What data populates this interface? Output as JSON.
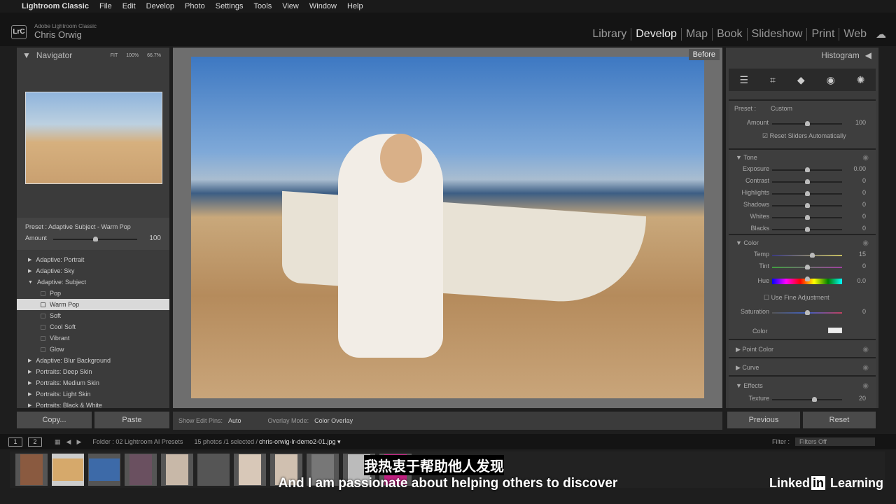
{
  "menubar": {
    "app": "Lightroom Classic",
    "items": [
      "File",
      "Edit",
      "Develop",
      "Photo",
      "Settings",
      "Tools",
      "View",
      "Window",
      "Help"
    ]
  },
  "identity": {
    "logo": "LrC",
    "product": "Adobe Lightroom Classic",
    "user": "Chris Orwig"
  },
  "modules": [
    {
      "label": "Library",
      "active": false
    },
    {
      "label": "Develop",
      "active": true
    },
    {
      "label": "Map",
      "active": false
    },
    {
      "label": "Book",
      "active": false
    },
    {
      "label": "Slideshow",
      "active": false
    },
    {
      "label": "Print",
      "active": false
    },
    {
      "label": "Web",
      "active": false
    }
  ],
  "navigator": {
    "title": "Navigator",
    "zooms": [
      "FIT",
      "100%",
      "66.7%"
    ]
  },
  "preset_box": {
    "label": "Preset : Adaptive Subject - Warm Pop",
    "amount_label": "Amount",
    "amount": "100",
    "amount_fraction": 0.5
  },
  "presets": [
    {
      "label": "Adaptive: Portrait",
      "type": "group",
      "open": false
    },
    {
      "label": "Adaptive: Sky",
      "type": "group",
      "open": false
    },
    {
      "label": "Adaptive: Subject",
      "type": "group",
      "open": true
    },
    {
      "label": "Pop",
      "type": "item"
    },
    {
      "label": "Warm Pop",
      "type": "item",
      "selected": true
    },
    {
      "label": "Soft",
      "type": "item"
    },
    {
      "label": "Cool Soft",
      "type": "item"
    },
    {
      "label": "Vibrant",
      "type": "item"
    },
    {
      "label": "Glow",
      "type": "item"
    },
    {
      "label": "Adaptive: Blur Background",
      "type": "group",
      "open": false
    },
    {
      "label": "Portraits: Deep Skin",
      "type": "group",
      "open": false
    },
    {
      "label": "Portraits: Medium Skin",
      "type": "group",
      "open": false
    },
    {
      "label": "Portraits: Light Skin",
      "type": "group",
      "open": false
    },
    {
      "label": "Portraits: Black & White",
      "type": "group",
      "open": false
    }
  ],
  "left_buttons": {
    "copy": "Copy...",
    "paste": "Paste"
  },
  "center": {
    "before_label": "Before",
    "show_edit_pins_label": "Show Edit Pins:",
    "show_edit_pins": "Auto",
    "overlay_mode_label": "Overlay Mode:",
    "overlay_mode": "Color Overlay"
  },
  "right": {
    "histogram": "Histogram",
    "preset_label": "Preset :",
    "preset_value": "Custom",
    "amount_label": "Amount",
    "amount": "100",
    "reset_sliders": "Reset Sliders Automatically",
    "tone": {
      "title": "Tone",
      "sliders": [
        {
          "label": "Exposure",
          "value": "0.00",
          "pos": 0.5
        },
        {
          "label": "Contrast",
          "value": "0",
          "pos": 0.5
        },
        {
          "label": "Highlights",
          "value": "0",
          "pos": 0.5
        },
        {
          "label": "Shadows",
          "value": "0",
          "pos": 0.5
        },
        {
          "label": "Whites",
          "value": "0",
          "pos": 0.5
        },
        {
          "label": "Blacks",
          "value": "0",
          "pos": 0.5
        }
      ]
    },
    "color": {
      "title": "Color",
      "temp": {
        "label": "Temp",
        "value": "15"
      },
      "tint": {
        "label": "Tint",
        "value": "0"
      },
      "hue": {
        "label": "Hue",
        "value": "0.0"
      },
      "fine": "Use Fine Adjustment",
      "saturation": {
        "label": "Saturation",
        "value": "0"
      },
      "color_label": "Color"
    },
    "point_color": "Point Color",
    "curve": "Curve",
    "effects": {
      "title": "Effects",
      "texture": {
        "label": "Texture",
        "value": "20"
      }
    }
  },
  "right_buttons": {
    "previous": "Previous",
    "reset": "Reset"
  },
  "filmbar": {
    "views": [
      "1",
      "2"
    ],
    "folder": "Folder : 02 Lightroom AI Presets",
    "count": "15 photos /1 selected /",
    "file": "chris-orwig-lr-demo2-01.jpg",
    "filter_label": "Filter :",
    "filter_value": "Filters Off"
  },
  "thumbs": [
    "#8a5a40",
    "#d6a96b",
    "#3d6aa8",
    "#6a5060",
    "#c8b8a8",
    "#555",
    "#d8c8b8",
    "#d0c0b0",
    "#777",
    "#bbb",
    "#c02080"
  ],
  "subtitle": {
    "zh": "我热衷于帮助他人发现",
    "en": "And I am passionate about helping others to discover"
  },
  "watermark": {
    "brand": "LinkedIn Learning"
  }
}
